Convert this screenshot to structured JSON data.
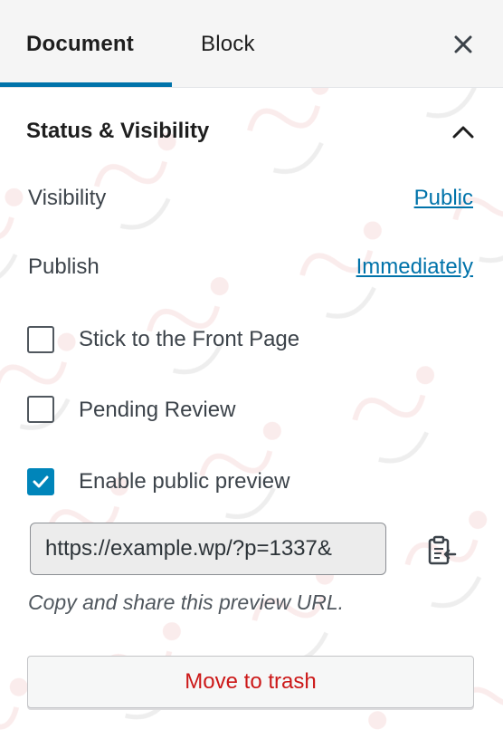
{
  "tabs": [
    {
      "label": "Document",
      "active": true
    },
    {
      "label": "Block",
      "active": false
    }
  ],
  "header": {
    "close_icon": "close-icon"
  },
  "panel": {
    "title": "Status & Visibility",
    "expanded": true,
    "collapse_icon": "chevron-up-icon"
  },
  "visibility": {
    "label": "Visibility",
    "value": "Public"
  },
  "publish": {
    "label": "Publish",
    "value": "Immediately"
  },
  "checkboxes": [
    {
      "label": "Stick to the Front Page",
      "checked": false
    },
    {
      "label": "Pending Review",
      "checked": false
    },
    {
      "label": "Enable public preview",
      "checked": true
    }
  ],
  "preview": {
    "url": "https://example.wp/?p=1337&",
    "copy_icon": "clipboard-copy-icon",
    "hint": "Copy and share this preview URL."
  },
  "trash": {
    "label": "Move to trash"
  },
  "colors": {
    "accent": "#0073aa",
    "checkbox_checked": "#0085ba",
    "danger": "#cc1818",
    "header_bg": "#f5f5f5"
  }
}
